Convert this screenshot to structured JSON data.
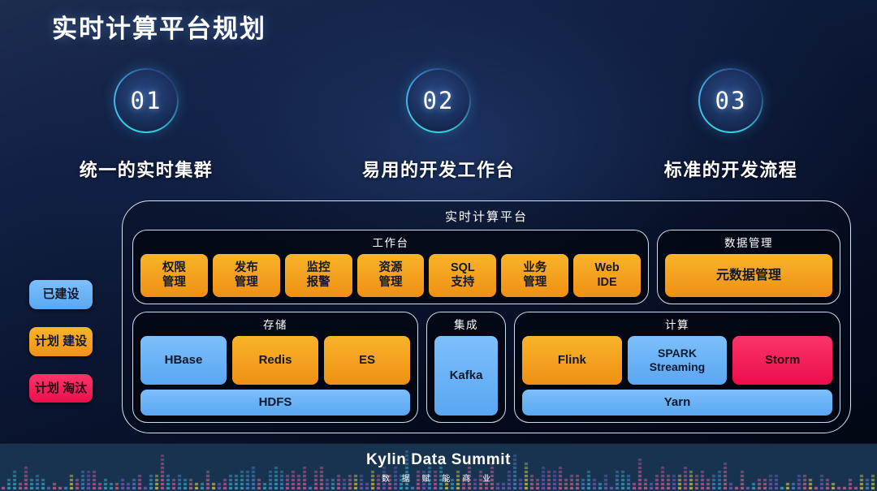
{
  "slide": {
    "title": "实时计算平台规划",
    "background_top_color": "#1d2d4e",
    "background_bottom_color": "#01060f"
  },
  "pillars": [
    {
      "number": "01",
      "label": "统一的实时集群"
    },
    {
      "number": "02",
      "label": "易用的开发工作台"
    },
    {
      "number": "03",
      "label": "标准的开发流程"
    }
  ],
  "legend": {
    "items": [
      {
        "label": "已建设",
        "status": "built",
        "color": "#5ba7f2"
      },
      {
        "label": "计划\n建设",
        "status": "planned",
        "color": "#f09216"
      },
      {
        "label": "计划\n淘汰",
        "status": "deprecate",
        "color": "#ec0f4d"
      }
    ]
  },
  "platform": {
    "title": "实时计算平台",
    "groups": {
      "workbench": {
        "title": "工作台",
        "tiles": [
          {
            "label": "权限\n管理",
            "color": "orange"
          },
          {
            "label": "发布\n管理",
            "color": "orange"
          },
          {
            "label": "监控\n报警",
            "color": "orange"
          },
          {
            "label": "资源\n管理",
            "color": "orange"
          },
          {
            "label": "SQL\n支持",
            "color": "orange"
          },
          {
            "label": "业务\n管理",
            "color": "orange"
          },
          {
            "label": "Web\nIDE",
            "color": "orange"
          }
        ]
      },
      "data_management": {
        "title": "数据管理",
        "tiles": [
          {
            "label": "元数据管理",
            "color": "orange"
          }
        ]
      },
      "storage": {
        "title": "存储",
        "tiles_row": [
          {
            "label": "HBase",
            "color": "blue"
          },
          {
            "label": "Redis",
            "color": "orange"
          },
          {
            "label": "ES",
            "color": "orange"
          }
        ],
        "tiles_bar": [
          {
            "label": "HDFS",
            "color": "blue"
          }
        ]
      },
      "integration": {
        "title": "集成",
        "tiles": [
          {
            "label": "Kafka",
            "color": "blue"
          }
        ]
      },
      "compute": {
        "title": "计算",
        "tiles_row": [
          {
            "label": "Flink",
            "color": "orange"
          },
          {
            "label": "SPARK\nStreaming",
            "color": "blue"
          },
          {
            "label": "Storm",
            "color": "pink"
          }
        ],
        "tiles_bar": [
          {
            "label": "Yarn",
            "color": "blue"
          }
        ]
      }
    }
  },
  "footer": {
    "main": "Kylin Data Summit",
    "sub": "数 据 赋 能 商 业",
    "background_color": "#173350"
  }
}
